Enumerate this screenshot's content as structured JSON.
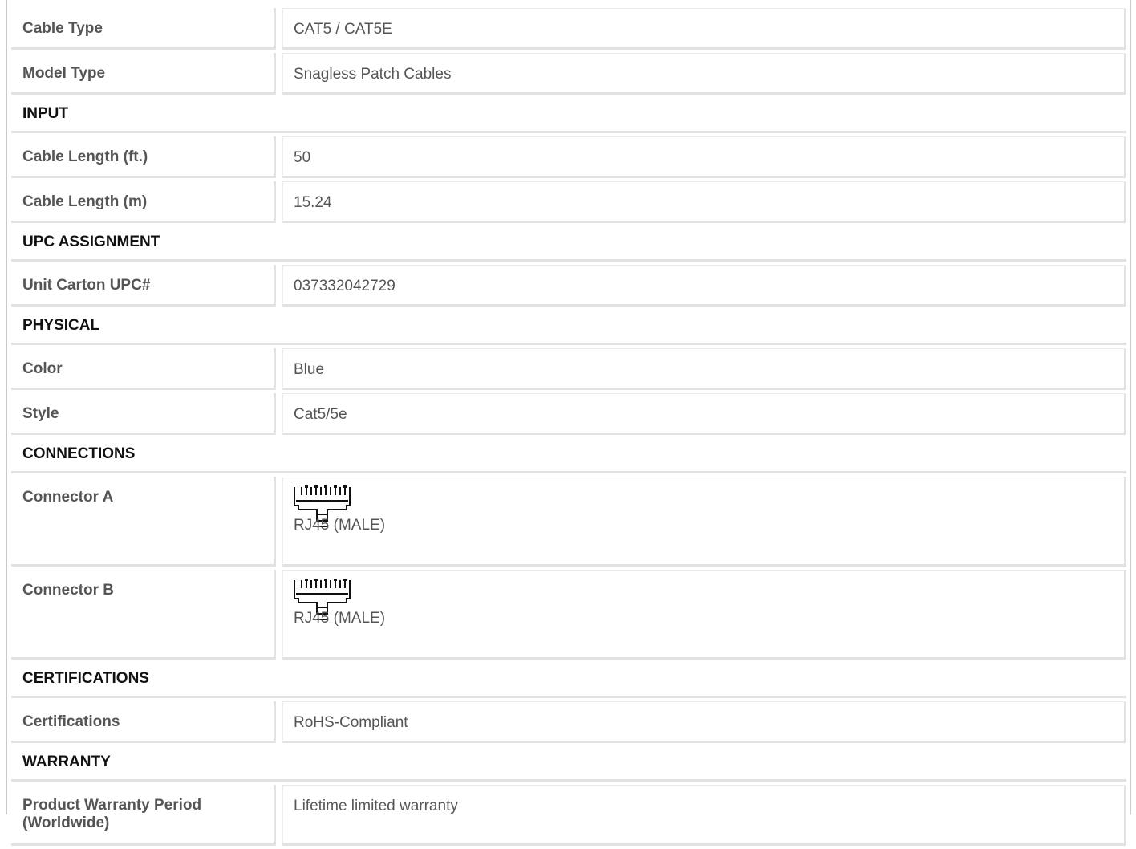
{
  "rows": [
    {
      "type": "row",
      "label": "Cable Type",
      "value": "CAT5 / CAT5E"
    },
    {
      "type": "row",
      "label": "Model Type",
      "value": "Snagless Patch Cables"
    }
  ],
  "sections": {
    "input": {
      "title": "INPUT",
      "rows": [
        {
          "label": "Cable Length (ft.)",
          "value": "50"
        },
        {
          "label": "Cable Length (m)",
          "value": "15.24"
        }
      ]
    },
    "upc": {
      "title": "UPC ASSIGNMENT",
      "rows": [
        {
          "label": "Unit Carton UPC#",
          "value": "037332042729"
        }
      ]
    },
    "physical": {
      "title": "PHYSICAL",
      "rows": [
        {
          "label": "Color",
          "value": "Blue"
        },
        {
          "label": "Style",
          "value": "Cat5/5e"
        }
      ]
    },
    "connections": {
      "title": "CONNECTIONS",
      "rows": [
        {
          "label": "Connector A",
          "icon": "rj45-connector-icon",
          "value": "RJ45 (MALE)"
        },
        {
          "label": "Connector B",
          "icon": "rj45-connector-icon",
          "value": "RJ45 (MALE)"
        }
      ]
    },
    "certifications": {
      "title": "CERTIFICATIONS",
      "rows": [
        {
          "label": "Certifications",
          "value": "RoHS-Compliant"
        }
      ]
    },
    "warranty": {
      "title": "WARRANTY",
      "rows": [
        {
          "label": "Product Warranty Period (Worldwide)",
          "value": "Lifetime limited warranty"
        }
      ]
    }
  }
}
